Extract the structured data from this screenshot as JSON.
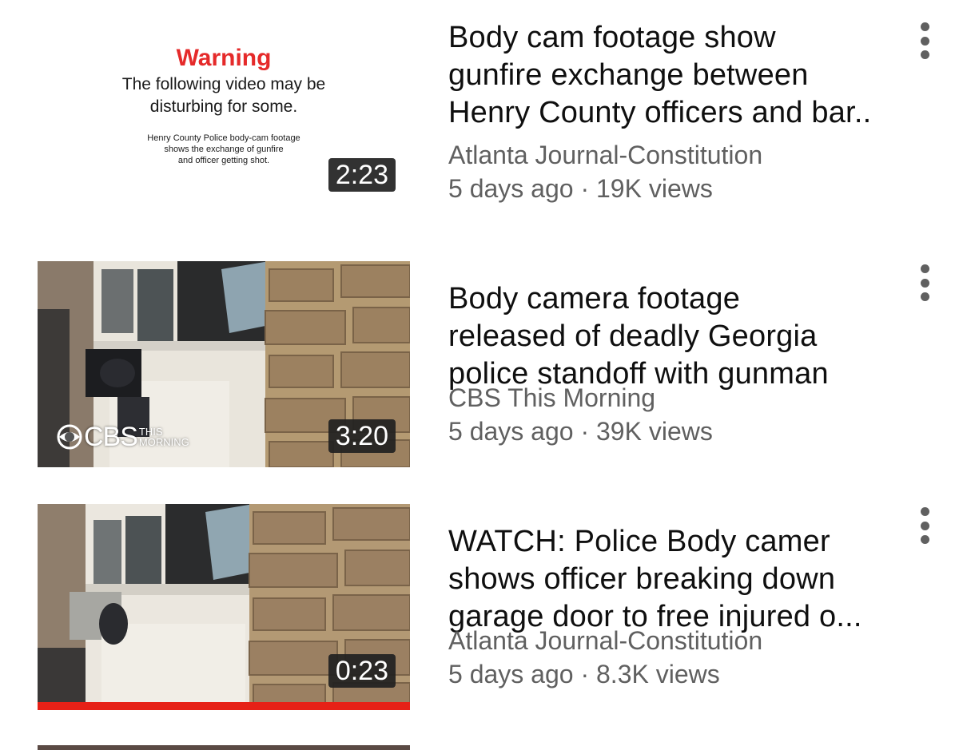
{
  "videos": [
    {
      "title_lines": [
        "Body cam footage show",
        "gunfire exchange between",
        "Henry County officers and bar.."
      ],
      "channel": "Atlanta Journal-Constitution",
      "meta": "5 days ago · 19K views",
      "duration": "2:23",
      "thumbnail": {
        "type": "warning-card",
        "warning": "Warning",
        "line1": "The following video may be",
        "line2": "disturbing for some.",
        "small1": "Henry County Police body-cam footage",
        "small2": "shows the exchange of gunfire",
        "small3": "and officer getting shot."
      }
    },
    {
      "title_lines": [
        "Body camera footage",
        "released of deadly Georgia",
        "police standoff with gunman"
      ],
      "channel": "CBS This Morning",
      "meta": "5 days ago · 39K views",
      "duration": "3:20",
      "thumbnail": {
        "type": "bodycam-scene",
        "logo_main": "CBS",
        "logo_sub1": "THIS",
        "logo_sub2": "MORNING"
      }
    },
    {
      "title_lines": [
        "WATCH: Police Body camer",
        "shows officer breaking down",
        "garage door to free injured o..."
      ],
      "channel": "Atlanta Journal-Constitution",
      "meta": "5 days ago · 8.3K views",
      "duration": "0:23",
      "watched_fraction": 1.0,
      "thumbnail": {
        "type": "bodycam-scene"
      }
    }
  ],
  "colors": {
    "warning_red": "#e52a2a",
    "progress_red": "#e62117",
    "secondary_text": "#606060",
    "title_text": "#0f0f0f"
  },
  "icons": {
    "more": "more-vert-icon",
    "logo_eye": "cbs-eye-icon"
  }
}
